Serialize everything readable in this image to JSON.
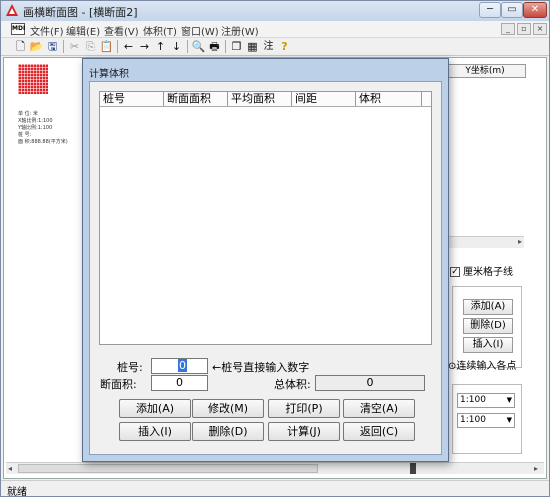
{
  "window": {
    "title": "画横断面图 - [横断面2]",
    "min_label": "─",
    "max_label": "▭",
    "close_label": "✕"
  },
  "menu": {
    "items": [
      "文件(F)",
      "编辑(E)",
      "查看(V)",
      "体积(T)",
      "窗口(W)",
      "注册(W)"
    ],
    "mdi_controls": [
      "_",
      "▫",
      "×"
    ]
  },
  "toolbar": {
    "icons": [
      "new-icon",
      "open-icon",
      "save-icon",
      "cut-icon",
      "copy-icon",
      "paste-icon",
      "arrow-left-icon",
      "arrow-right-icon",
      "arrow-up-icon",
      "arrow-down-icon",
      "preview-icon",
      "print-icon",
      "window-icon",
      "grid-icon",
      "note-icon",
      "help-icon"
    ],
    "note_label": "注"
  },
  "canvas": {
    "info_lines": [
      "单    位: 米",
      "X轴比例:1:100",
      "Y轴比例:1:100",
      "桩    号:",
      "面    积:888.88(平方米)"
    ]
  },
  "right_panel": {
    "header": "Y坐标(m)",
    "grid_checkbox": "厘米格子线",
    "buttons": [
      "添加(A)",
      "删除(D)",
      "插入(I)"
    ],
    "continuous_label": "⊙连续输入各点",
    "scale_values": [
      "1:100",
      "1:100"
    ]
  },
  "status": {
    "text": "就绪"
  },
  "dialog": {
    "title": "计算体积",
    "columns": [
      "桩号",
      "断面面积",
      "平均面积",
      "间距",
      "体积"
    ],
    "pile_label": "桩号:",
    "pile_value": "0",
    "pile_hint": "←桩号直接输入数字",
    "area_label": "断面积:",
    "area_value": "0",
    "total_label": "总体积:",
    "total_value": "0",
    "buttons": {
      "add": "添加(A)",
      "modify": "修改(M)",
      "print": "打印(P)",
      "clear": "清空(A)",
      "insert": "插入(I)",
      "delete": "删除(D)",
      "calculate": "计算(J)",
      "return": "返回(C)"
    }
  }
}
